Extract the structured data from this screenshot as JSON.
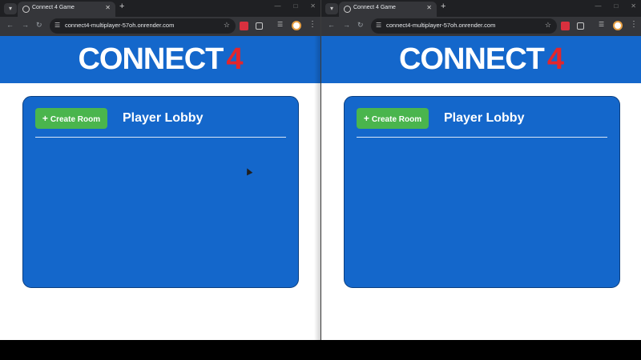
{
  "windows": [
    {
      "tab_title": "Connect 4 Game",
      "url": "connect4-multiplayer-57oh.onrender.com",
      "logo_text": "CONNECT",
      "logo_number": "4",
      "create_button_label": "Create Room",
      "lobby_title": "Player Lobby"
    },
    {
      "tab_title": "Connect 4 Game",
      "url": "connect4-multiplayer-57oh.onrender.com",
      "logo_text": "CONNECT",
      "logo_number": "4",
      "create_button_label": "Create Room",
      "lobby_title": "Player Lobby"
    }
  ],
  "colors": {
    "header": "#1467cb",
    "lobby_panel": "#1467cb",
    "create_button": "#4ab54d",
    "logo_accent": "#e3262c"
  },
  "icons": {
    "tab_favicon": "globe-icon",
    "new_tab": "plus-icon",
    "site_info": "tune-icon",
    "bookmark": "star-icon",
    "create_room": "plus-icon"
  }
}
